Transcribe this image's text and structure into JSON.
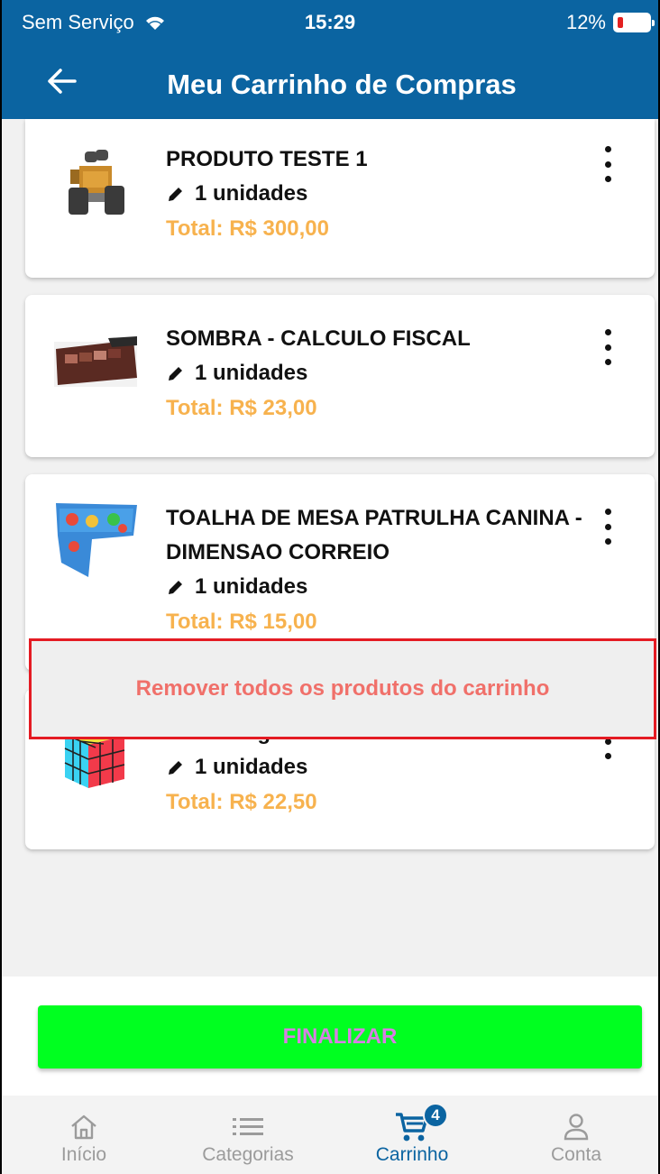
{
  "status": {
    "carrier": "Sem Serviço",
    "time": "15:29",
    "battery": "12%"
  },
  "header": {
    "title": "Meu Carrinho de Compras"
  },
  "cart": {
    "items": [
      {
        "name": "PRODUTO TESTE 1",
        "qty": "1 unidades",
        "total": "Total: R$ 300,00",
        "image": "robot-toy"
      },
      {
        "name": "SOMBRA - CALCULO FISCAL",
        "qty": "1 unidades",
        "total": "Total: R$ 23,00",
        "image": "eyeshadow-palette"
      },
      {
        "name": "TOALHA DE MESA PATRULHA CANINA - DIMENSAO CORREIO",
        "qty": "1 unidades",
        "total": "Total: R$ 15,00",
        "image": "tablecloth"
      },
      {
        "name": "Cubo Magico",
        "qty": "1 unidades",
        "total": "Total: R$ 22,50",
        "image": "rubiks-cube"
      }
    ],
    "remove_all_label": "Remover todos os produtos do carrinho",
    "checkout_label": "FINALIZAR"
  },
  "tabs": [
    {
      "label": "Início",
      "icon": "home-icon"
    },
    {
      "label": "Categorias",
      "icon": "list-icon"
    },
    {
      "label": "Carrinho",
      "icon": "cart-icon",
      "badge": "4",
      "active": true
    },
    {
      "label": "Conta",
      "icon": "user-icon"
    }
  ],
  "colors": {
    "primary": "#0b64a1",
    "price": "#f7b24e",
    "checkout": "#00ff20",
    "remove_text": "#f0706a",
    "remove_border": "#e41b23"
  }
}
